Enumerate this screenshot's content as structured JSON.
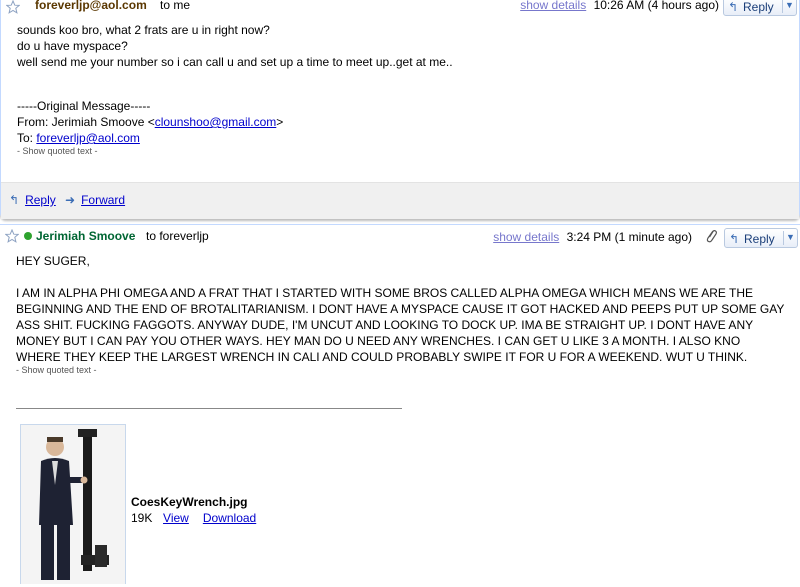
{
  "message1": {
    "sender": "foreverljp@aol.com",
    "to": "to me",
    "show_details": "show details",
    "time": "10:26 AM (4 hours ago)",
    "reply_label": "Reply",
    "body_lines": [
      "sounds koo bro, what 2 frats are u in right now?",
      "do u have myspace?",
      "well send me your number so i can call u and set up a time to meet up..get at me.."
    ],
    "original_header": "-----Original Message-----",
    "from_prefix": "From: Jerimiah Smoove <",
    "from_email": "clounshoo@gmail.com",
    "from_suffix": ">",
    "to_prefix": "To: ",
    "to_email": "foreverljp@aol.com",
    "show_quoted": "- Show quoted text -",
    "actions": {
      "reply": "Reply",
      "forward": "Forward"
    }
  },
  "message2": {
    "sender": "Jerimiah Smoove",
    "to": "to foreverljp",
    "show_details": "show details",
    "time": "3:24 PM (1 minute ago)",
    "reply_label": "Reply",
    "greeting": "HEY SUGER,",
    "body": "I AM IN ALPHA PHI OMEGA AND A FRAT THAT I STARTED WITH SOME BROS CALLED ALPHA OMEGA WHICH MEANS WE ARE THE BEGINNING AND THE END OF BROTALITARIANISM.  I DONT HAVE A MYSPACE CAUSE IT GOT HACKED AND PEEPS PUT UP SOME GAY ASS SHIT.  FUCKING FAGGOTS.  ANYWAY DUDE, I'M UNCUT AND LOOKING TO DOCK UP.   IMA BE STRAIGHT UP.  I DONT HAVE ANY MONEY BUT I CAN PAY YOU OTHER WAYS.  HEY MAN DO U NEED ANY WRENCHES.  I CAN GET U LIKE 3 A MONTH.  I ALSO KNO WHERE THEY KEEP THE LARGEST WRENCH IN CALI AND COULD PROBABLY SWIPE IT FOR U FOR A WEEKEND.  WUT U THINK.",
    "show_quoted": "- Show quoted text -",
    "attachment": {
      "filename": "CoesKeyWrench.jpg",
      "size": "19K",
      "view": "View",
      "download": "Download"
    }
  },
  "icons": [
    "star-icon",
    "reply-arrow-icon",
    "dropdown-icon",
    "forward-arrow-icon",
    "online-dot-icon",
    "paperclip-icon"
  ],
  "colors": {
    "link": "#0000cc",
    "sender1": "#5a3700",
    "sender2": "#006633",
    "online": "#2ea32e"
  }
}
